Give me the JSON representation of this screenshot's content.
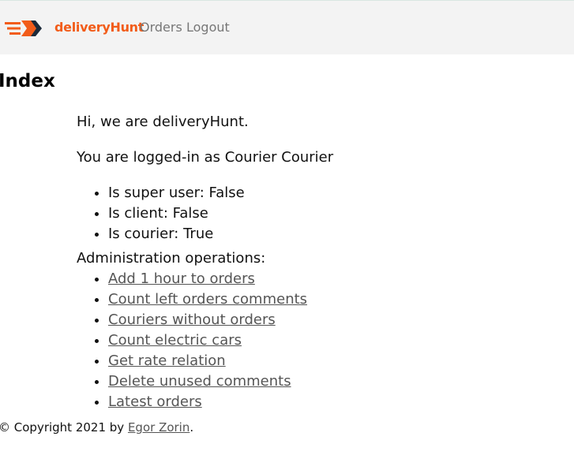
{
  "navbar": {
    "brand": "deliveryHunt",
    "links": [
      "Orders",
      "Logout"
    ],
    "logo_icon": "delivery-arrow-logo-icon",
    "colors": {
      "brand": "#f25c19",
      "brand_dark": "#1d2b3a",
      "background": "#f3f3f3",
      "link": "#777777"
    }
  },
  "main": {
    "title": "Index",
    "greeting": "Hi, we are deliveryHunt.",
    "logged_in_text": "You are logged-in as Courier Courier",
    "flags": [
      "Is super user: False",
      "Is client: False",
      "Is courier: True"
    ],
    "admin_label": "Administration operations:",
    "operations": [
      "Add 1 hour to orders",
      "Count left orders comments",
      "Couriers without orders",
      "Count electric cars",
      "Get rate relation",
      "Delete unused comments",
      "Latest orders"
    ]
  },
  "footer": {
    "prefix": "© Copyright 2021 by ",
    "author": "Egor Zorin",
    "suffix": "."
  }
}
